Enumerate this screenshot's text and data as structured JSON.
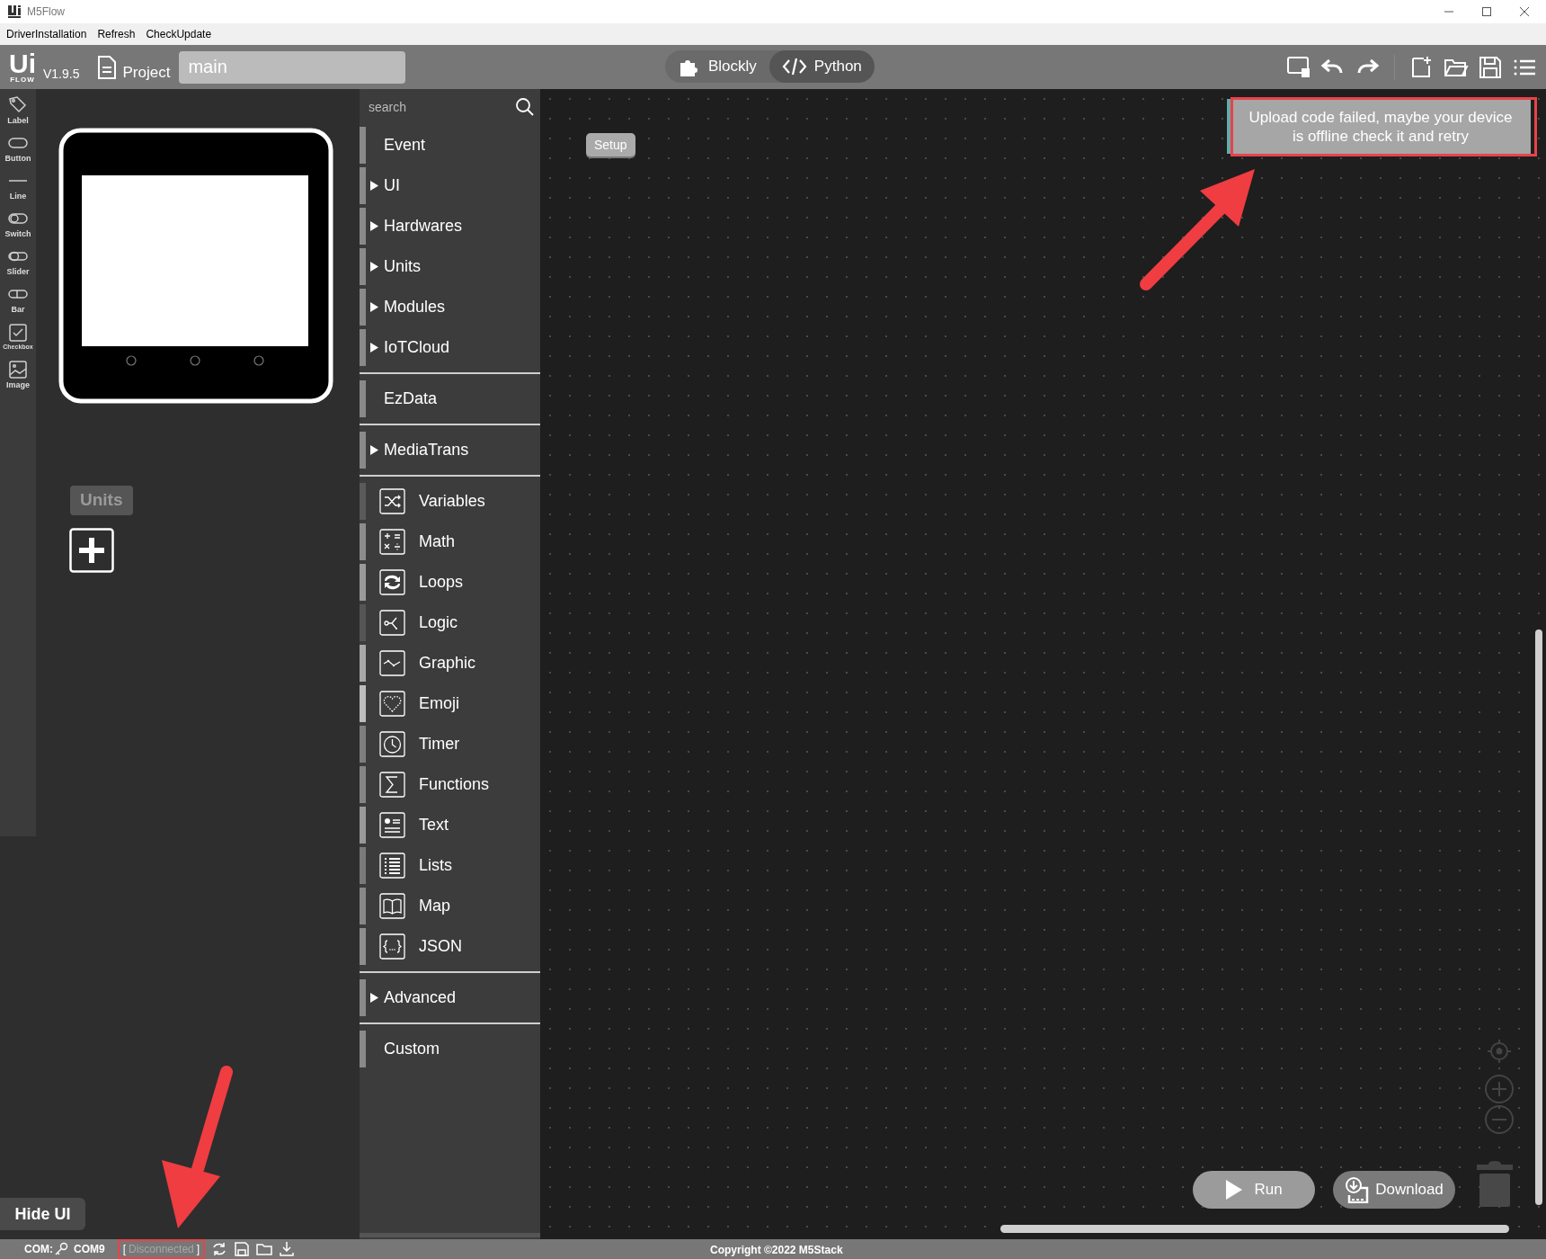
{
  "window": {
    "title": "M5Flow"
  },
  "menu": [
    "DriverInstallation",
    "Refresh",
    "CheckUpdate"
  ],
  "toolbar": {
    "logo_top": "Ui",
    "logo_bottom": "FLOW",
    "version": "V1.9.5",
    "project_label": "Project",
    "project_name": "main",
    "modes": [
      {
        "label": "Blockly",
        "selected": false,
        "kind": "puzzle"
      },
      {
        "label": "Python",
        "selected": true,
        "kind": "code"
      }
    ]
  },
  "widgets": [
    {
      "label": "Label",
      "kind": "label"
    },
    {
      "label": "Button",
      "kind": "button"
    },
    {
      "label": "Line",
      "kind": "line"
    },
    {
      "label": "Switch",
      "kind": "switch"
    },
    {
      "label": "Slider",
      "kind": "slider"
    },
    {
      "label": "Bar",
      "kind": "bar"
    },
    {
      "label": "Checkbox",
      "kind": "checkbox"
    },
    {
      "label": "Image",
      "kind": "image"
    }
  ],
  "units_panel": {
    "title": "Units"
  },
  "hide_ui": "Hide UI",
  "search": {
    "placeholder": "search"
  },
  "category_sections": [
    {
      "items": [
        {
          "label": "Event",
          "kind": "plain",
          "color": "#8a8a8a"
        },
        {
          "label": "UI",
          "kind": "expandable",
          "color": "#8a8a8a"
        },
        {
          "label": "Hardwares",
          "kind": "expandable",
          "color": "#8a8a8a"
        },
        {
          "label": "Units",
          "kind": "expandable",
          "color": "#8a8a8a"
        },
        {
          "label": "Modules",
          "kind": "expandable",
          "color": "#8a8a8a"
        },
        {
          "label": "IoTCloud",
          "kind": "expandable",
          "color": "#8a8a8a"
        }
      ]
    },
    {
      "items": [
        {
          "label": "EzData",
          "kind": "plain",
          "color": "#8a8a8a"
        }
      ]
    },
    {
      "items": [
        {
          "label": "MediaTrans",
          "kind": "expandable",
          "color": "#8a8a8a"
        }
      ]
    },
    {
      "items": [
        {
          "label": "Variables",
          "kind": "shuffle",
          "color": "#5a5a5a"
        },
        {
          "label": "Math",
          "kind": "math",
          "color": "#8c8c8c"
        },
        {
          "label": "Loops",
          "kind": "loops",
          "color": "#9a9a9a"
        },
        {
          "label": "Logic",
          "kind": "logic",
          "color": "#555555"
        },
        {
          "label": "Graphic",
          "kind": "graphic",
          "color": "#a8a8a8"
        },
        {
          "label": "Emoji",
          "kind": "emoji",
          "color": "#bdbdbd"
        },
        {
          "label": "Timer",
          "kind": "timer",
          "color": "#7e7e7e"
        },
        {
          "label": "Functions",
          "kind": "functions",
          "color": "#858585"
        },
        {
          "label": "Text",
          "kind": "text",
          "color": "#999999"
        },
        {
          "label": "Lists",
          "kind": "lists",
          "color": "#7a7a7a"
        },
        {
          "label": "Map",
          "kind": "map",
          "color": "#888888"
        },
        {
          "label": "JSON",
          "kind": "json",
          "color": "#8e8e8e"
        }
      ]
    },
    {
      "items": [
        {
          "label": "Advanced",
          "kind": "expandable",
          "color": "#8a8a8a"
        }
      ]
    },
    {
      "items": [
        {
          "label": "Custom",
          "kind": "plain",
          "color": "#8a8a8a"
        }
      ]
    }
  ],
  "canvas": {
    "setup_block": "Setup",
    "notification": "Upload code failed, maybe your device is offline check it and retry",
    "run": "Run",
    "download": "Download"
  },
  "status_bar": {
    "com_label": "COM:",
    "port": "COM9",
    "bracket_open": "[",
    "connection": "Disconnected",
    "connected": false,
    "bracket_close": "]",
    "copyright": "Copyright ©2022 M5Stack"
  }
}
